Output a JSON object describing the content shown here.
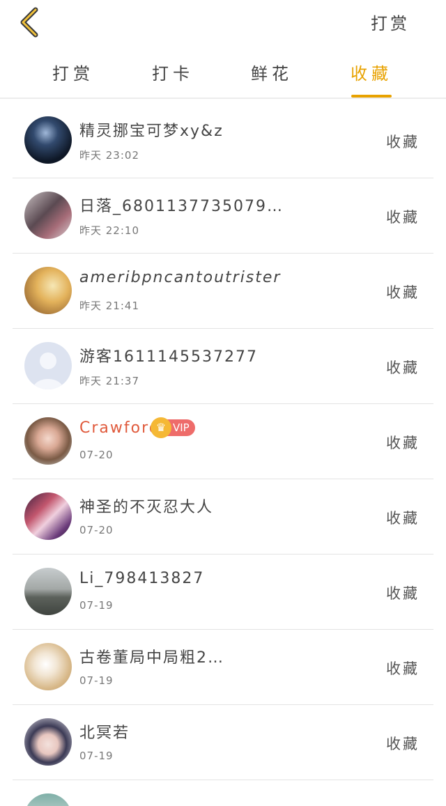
{
  "header": {
    "back_icon": "chevron-left-icon",
    "action_label": "打赏",
    "accent": "#e8a200"
  },
  "tabs": [
    {
      "label": "打赏",
      "active": false
    },
    {
      "label": "打卡",
      "active": false
    },
    {
      "label": "鲜花",
      "active": false
    },
    {
      "label": "收藏",
      "active": true
    }
  ],
  "list": {
    "items": [
      {
        "name": "精灵挪宝可梦xy&z",
        "time": "昨天 23:02",
        "action": "收藏",
        "vip": false
      },
      {
        "name": "日落_6801137735079…",
        "time": "昨天 22:10",
        "action": "收藏",
        "vip": false
      },
      {
        "name": "ameribpncantoutrister",
        "time": "昨天 21:41",
        "action": "收藏",
        "vip": false
      },
      {
        "name": "游客1611145537277",
        "time": "昨天 21:37",
        "action": "收藏",
        "vip": false
      },
      {
        "name": "Crawford",
        "time": "07-20",
        "action": "收藏",
        "vip": true,
        "badge": "VIP"
      },
      {
        "name": "神圣的不灭忍大人",
        "time": "07-20",
        "action": "收藏",
        "vip": false
      },
      {
        "name": "Li_798413827",
        "time": "07-19",
        "action": "收藏",
        "vip": false
      },
      {
        "name": "古卷董局中局粗2…",
        "time": "07-19",
        "action": "收藏",
        "vip": false
      },
      {
        "name": "北冥若",
        "time": "07-19",
        "action": "收藏",
        "vip": false
      }
    ]
  }
}
